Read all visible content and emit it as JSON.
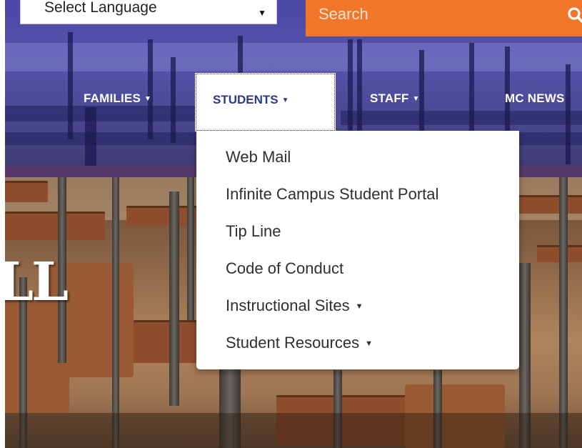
{
  "header": {
    "language_select": {
      "value": "Select Language"
    },
    "search": {
      "placeholder": "Search"
    }
  },
  "nav": {
    "items": [
      {
        "label": "FAMILIES",
        "has_caret": true
      },
      {
        "label": "STUDENTS",
        "has_caret": true,
        "active": true
      },
      {
        "label": "STAFF",
        "has_caret": true
      },
      {
        "label": "MC NEWS",
        "has_caret": false
      }
    ]
  },
  "dropdown": {
    "items": [
      {
        "label": "Web Mail"
      },
      {
        "label": "Infinite Campus Student Portal"
      },
      {
        "label": "Tip Line"
      },
      {
        "label": "Code of Conduct"
      },
      {
        "label": "Instructional Sites",
        "has_caret": true
      },
      {
        "label": "Student Resources",
        "has_caret": true
      }
    ]
  },
  "hero": {
    "partial_text": "LL"
  },
  "icons": {
    "select_arrow": "dropdown-triangle-icon",
    "search": "magnifier-icon",
    "caret": "caret-down-icon"
  },
  "colors": {
    "search_bg": "#f0762a",
    "active_nav_text": "#2b3a8a",
    "header_tint": "#4b49a6",
    "purple_strip": "#56386b"
  }
}
